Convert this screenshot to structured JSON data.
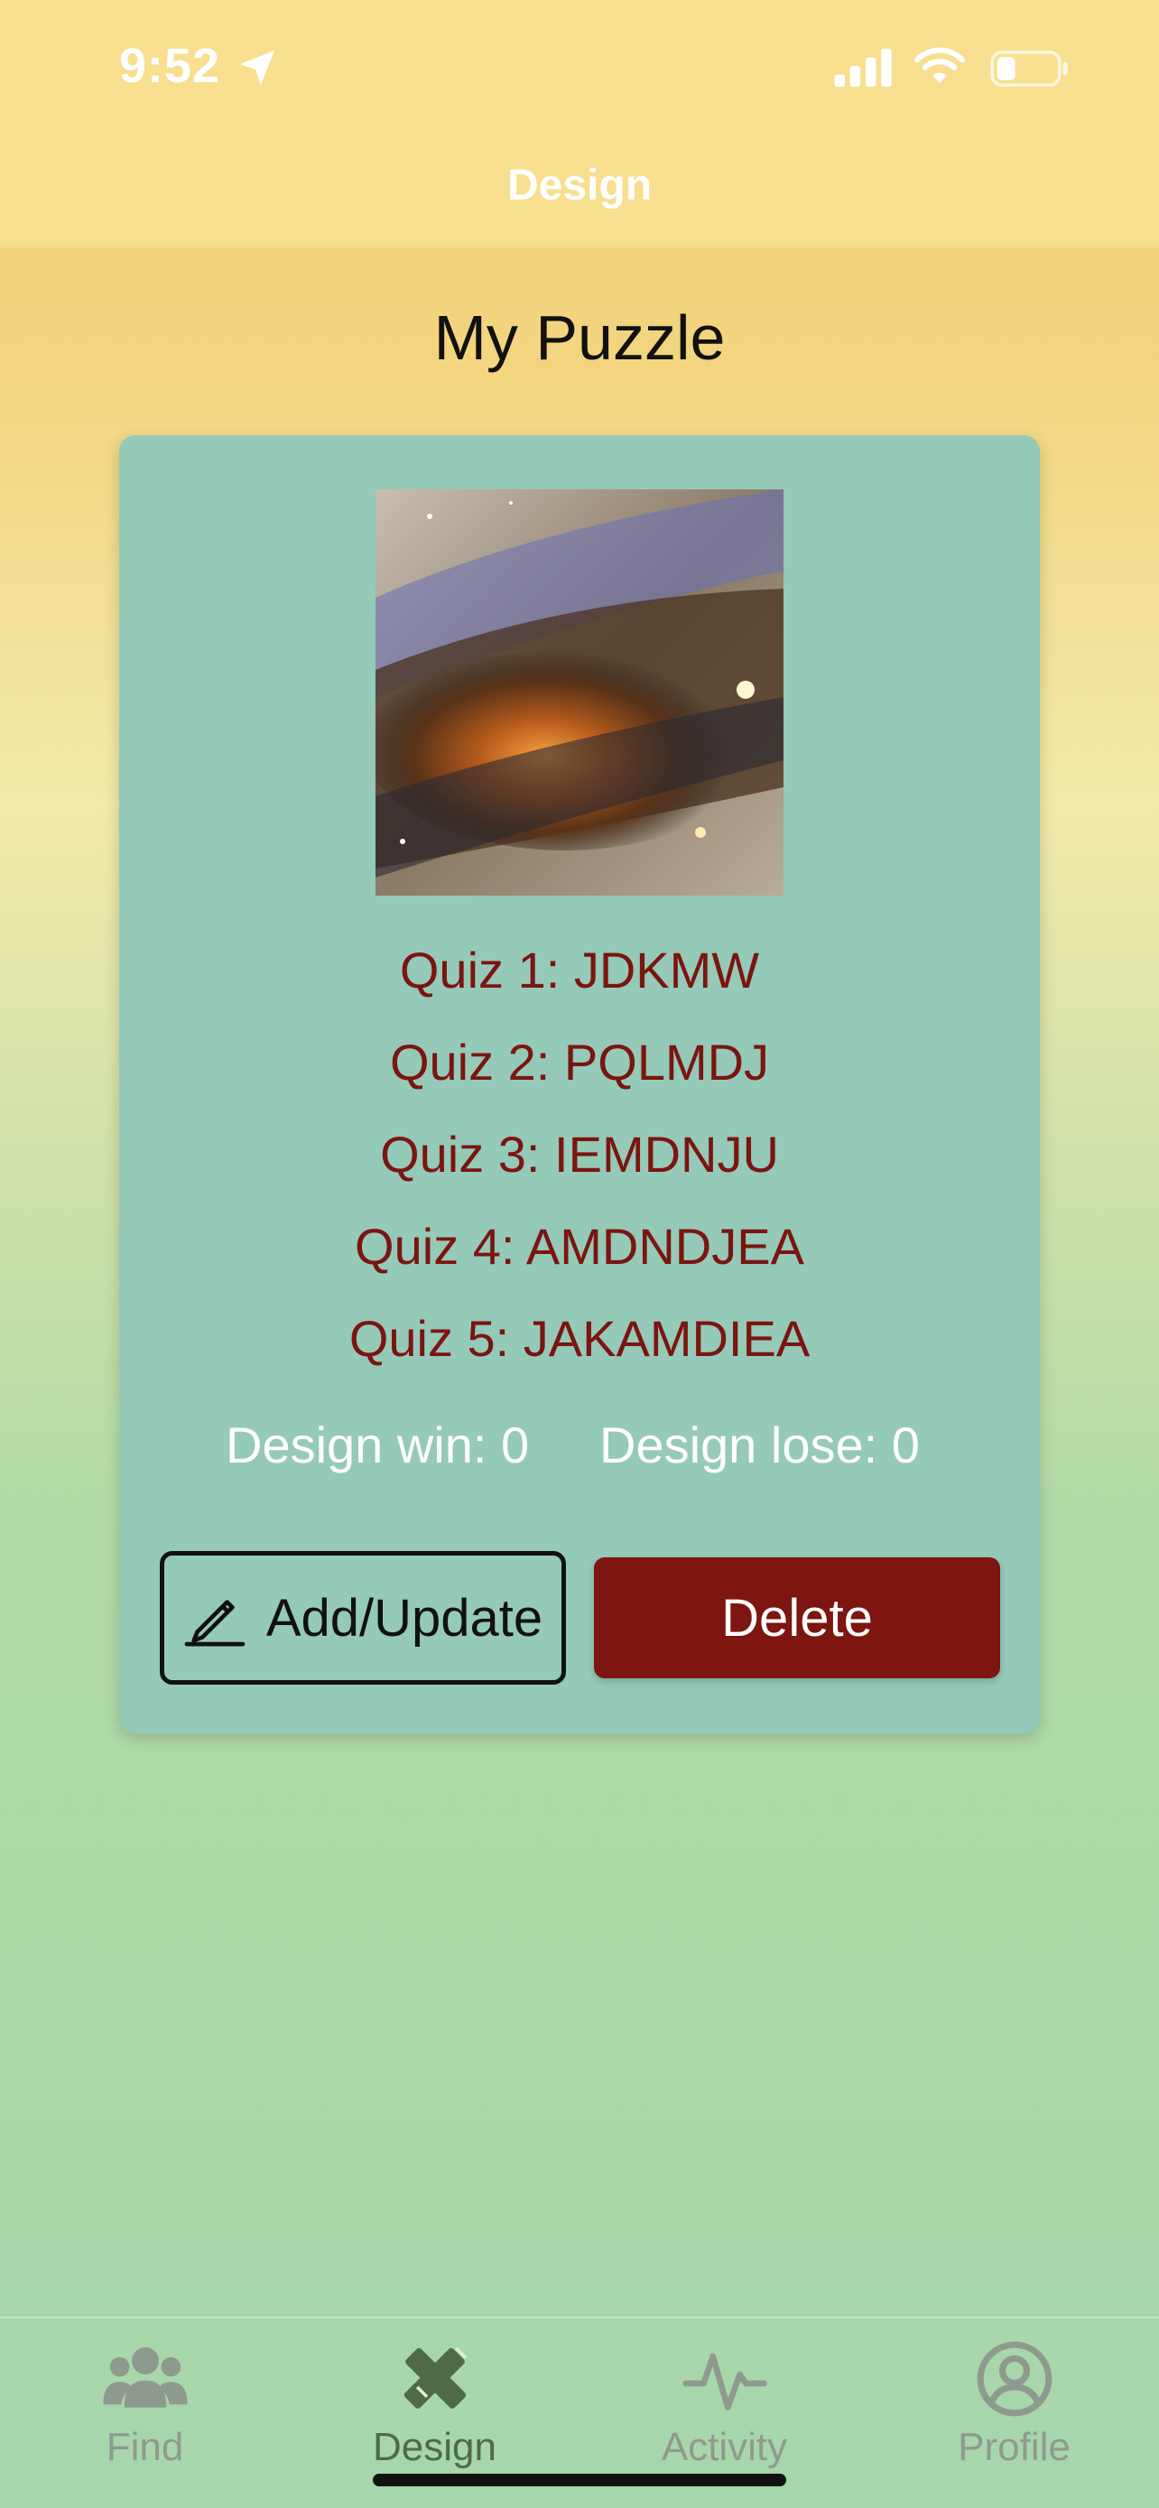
{
  "status_bar": {
    "time": "9:52"
  },
  "nav": {
    "title": "Design"
  },
  "page": {
    "title": "My Puzzle"
  },
  "card": {
    "quizzes": [
      "Quiz 1: JDKMW",
      "Quiz 2: PQLMDJ",
      "Quiz 3: IEMDNJU",
      "Quiz 4: AMDNDJEA",
      "Quiz 5: JAKAMDIEA"
    ],
    "design_win": "Design win: 0",
    "design_lose": "Design lose: 0",
    "edit_label": "Add/Update",
    "delete_label": "Delete"
  },
  "tabs": [
    {
      "label": "Find",
      "icon": "people-icon"
    },
    {
      "label": "Design",
      "icon": "pencil-ruler-icon"
    },
    {
      "label": "Activity",
      "icon": "activity-icon"
    },
    {
      "label": "Profile",
      "icon": "profile-icon"
    }
  ],
  "colors": {
    "header": "#f7df8f",
    "card": "#95c9b8",
    "quiz_text": "#7b1510",
    "delete_button": "#7d1510",
    "tab_inactive": "#8f9a8f",
    "tab_active": "#4f6b45"
  }
}
